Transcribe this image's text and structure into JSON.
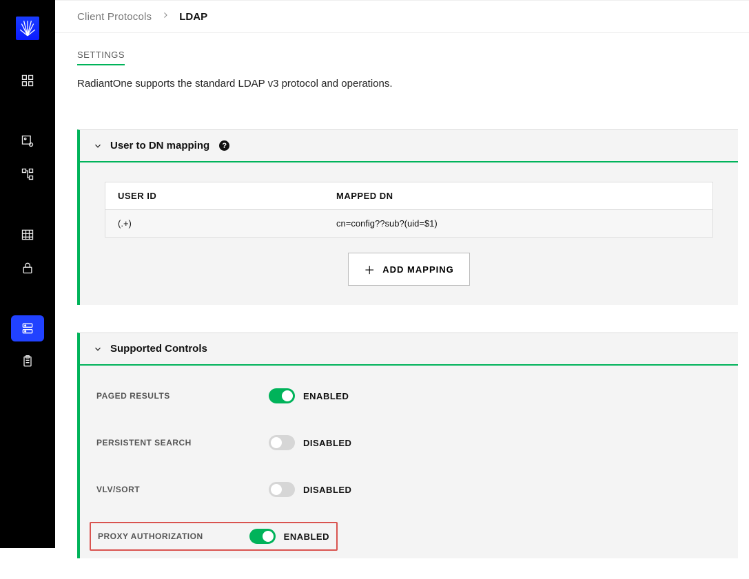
{
  "breadcrumb": {
    "root": "Client Protocols",
    "current": "LDAP"
  },
  "tabs": {
    "settings": "SETTINGS"
  },
  "description": "RadiantOne supports the standard LDAP v3 protocol and operations.",
  "mapping_panel": {
    "title": "User to DN mapping",
    "help_tooltip": "?",
    "columns": {
      "user_id": "USER ID",
      "mapped_dn": "MAPPED DN"
    },
    "rows": [
      {
        "user_id": "(.+)",
        "mapped_dn": "cn=config??sub?(uid=$1)"
      }
    ],
    "add_button": "ADD MAPPING"
  },
  "controls_panel": {
    "title": "Supported Controls",
    "labels": {
      "enabled": "ENABLED",
      "disabled": "DISABLED"
    },
    "items": [
      {
        "key": "paged",
        "label": "PAGED RESULTS",
        "on": true
      },
      {
        "key": "persistent",
        "label": "PERSISTENT SEARCH",
        "on": false
      },
      {
        "key": "vlv",
        "label": "VLV/SORT",
        "on": false
      },
      {
        "key": "proxy",
        "label": "PROXY AUTHORIZATION",
        "on": true,
        "highlight": true
      }
    ]
  }
}
